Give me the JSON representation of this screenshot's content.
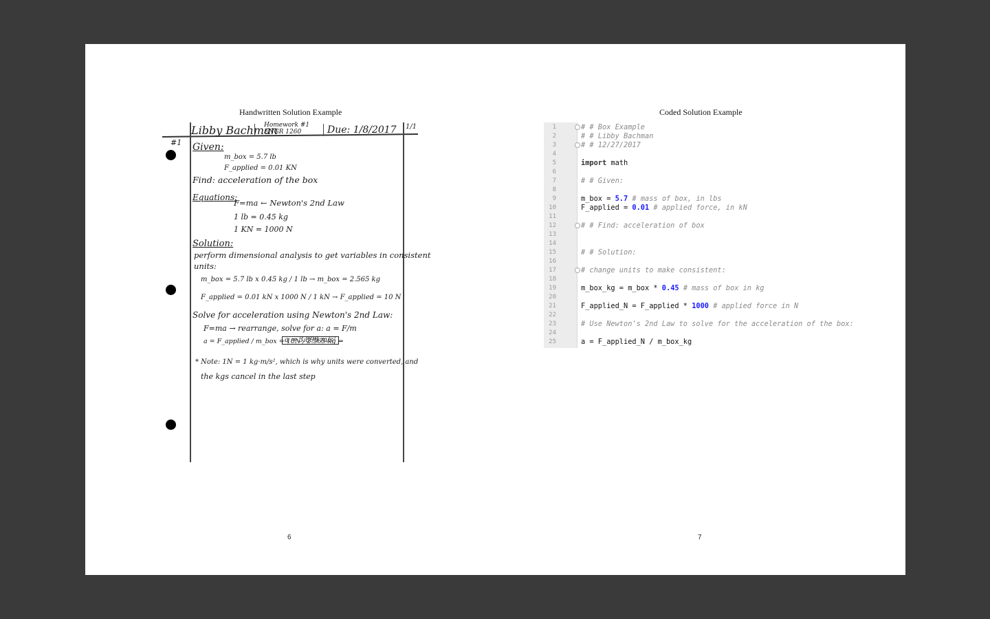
{
  "left_page": {
    "title": "Handwritten Solution Example",
    "page_number": "6",
    "handwriting": {
      "name": "Libby Bachman",
      "assignment": "Homework #1",
      "course": "ENGR 1260",
      "due": "Due: 1/8/2017",
      "page": "1/1",
      "problem": "#1",
      "given_heading": "Given:",
      "given_1": "m_box = 5.7 lb",
      "given_2": "F_applied = 0.01 KN",
      "find": "Find: acceleration of the box",
      "equations_heading": "Equations:",
      "eq_1": "F=ma ← Newton's 2nd Law",
      "eq_2": "1 lb = 0.45 kg",
      "eq_3": "1 KN = 1000 N",
      "solution_heading": "Solution:",
      "sol_1": "perform dimensional analysis to get variables in consistent",
      "sol_2": "units:",
      "sol_3": "m_box = 5.7 lb x 0.45 kg / 1 lb → m_box = 2.565 kg",
      "sol_4": "F_applied = 0.01 kN x 1000 N / 1 kN → F_applied = 10 N",
      "sol_5": "Solve for acceleration using Newton's 2nd Law:",
      "sol_6": "F=ma → rearrange, solve for a:   a = F/m",
      "sol_7": "a = F_applied / m_box = 10N / 2.565 kg ⇒",
      "sol_answer": "a = 3.899 m/s²",
      "note_1": "* Note: 1N = 1 kg·m/s², which is why units were converted, and",
      "note_2": "the kgs cancel in the last step"
    }
  },
  "right_page": {
    "title": "Coded Solution Example",
    "page_number": "7",
    "code_lines": [
      {
        "n": "1",
        "text": "# # Box Example"
      },
      {
        "n": "2",
        "text": "# # Libby Bachman"
      },
      {
        "n": "3",
        "text": "# # 12/27/2017"
      },
      {
        "n": "4",
        "text": ""
      },
      {
        "n": "5",
        "text": "import math"
      },
      {
        "n": "6",
        "text": ""
      },
      {
        "n": "7",
        "text": "# # Given:"
      },
      {
        "n": "8",
        "text": ""
      },
      {
        "n": "9",
        "text": "m_box = 5.7  # mass of box, in lbs"
      },
      {
        "n": "10",
        "text": "F_applied = 0.01  # applied force, in kN"
      },
      {
        "n": "11",
        "text": ""
      },
      {
        "n": "12",
        "text": "# # Find: acceleration of box"
      },
      {
        "n": "13",
        "text": ""
      },
      {
        "n": "14",
        "text": ""
      },
      {
        "n": "15",
        "text": "# # Solution:"
      },
      {
        "n": "16",
        "text": ""
      },
      {
        "n": "17",
        "text": "# change units to make consistent:"
      },
      {
        "n": "18",
        "text": ""
      },
      {
        "n": "19",
        "text": "m_box_kg = m_box * 0.45  # mass of box in kg"
      },
      {
        "n": "20",
        "text": ""
      },
      {
        "n": "21",
        "text": "F_applied_N = F_applied * 1000  # applied force in N"
      },
      {
        "n": "22",
        "text": ""
      },
      {
        "n": "23",
        "text": "# Use Newton's 2nd Law to solve for the acceleration of the box:"
      },
      {
        "n": "24",
        "text": ""
      },
      {
        "n": "25",
        "text": "a = F_applied_N / m_box_kg"
      }
    ]
  }
}
